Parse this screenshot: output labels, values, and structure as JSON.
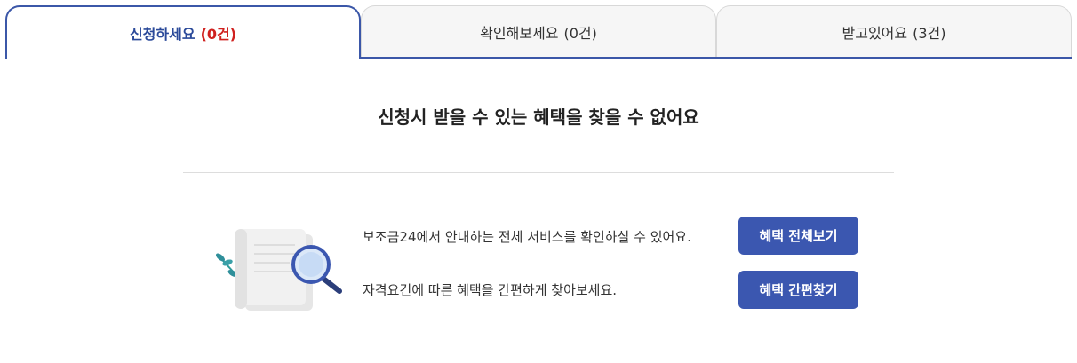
{
  "tabs": [
    {
      "label": "신청하세요",
      "count": "(0건)",
      "active": true
    },
    {
      "label": "확인해보세요",
      "count": "(0건)",
      "active": false
    },
    {
      "label": "받고있어요",
      "count": "(3건)",
      "active": false
    }
  ],
  "empty_state": {
    "title": "신청시 받을 수 있는 혜택을 찾을 수 없어요"
  },
  "actions": [
    {
      "text": "보조금24에서 안내하는 전체 서비스를 확인하실 수 있어요.",
      "button": "혜택 전체보기"
    },
    {
      "text": "자격요건에 따른 혜택을 간편하게 찾아보세요.",
      "button": "혜택 간편찾기"
    }
  ],
  "colors": {
    "accent": "#3b57a8",
    "count_highlight": "#d0211f",
    "button_bg": "#3b57b0"
  },
  "illustration": {
    "icon": "document-magnifier-icon"
  }
}
